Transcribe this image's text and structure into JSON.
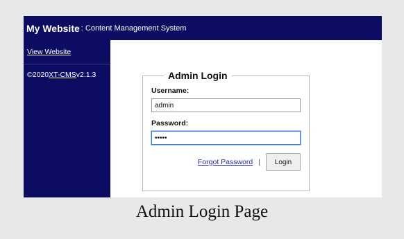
{
  "header": {
    "site_name": "My Website",
    "subtitle": " : Content Management System"
  },
  "sidebar": {
    "view_website": "View Website",
    "copyright_prefix": "©2020 ",
    "product": "XT-CMS",
    "version": " v2.1.3"
  },
  "login_form": {
    "legend": "Admin Login",
    "username_label": "Username:",
    "username_value": "admin",
    "password_label": "Password:",
    "password_value": "•••••",
    "forgot_password": "Forgot Password",
    "separator": "|",
    "login_button": "Login"
  },
  "caption": "Admin Login Page",
  "colors": {
    "nav_background": "#0c0c63",
    "focus_border": "#3c7dd9"
  }
}
